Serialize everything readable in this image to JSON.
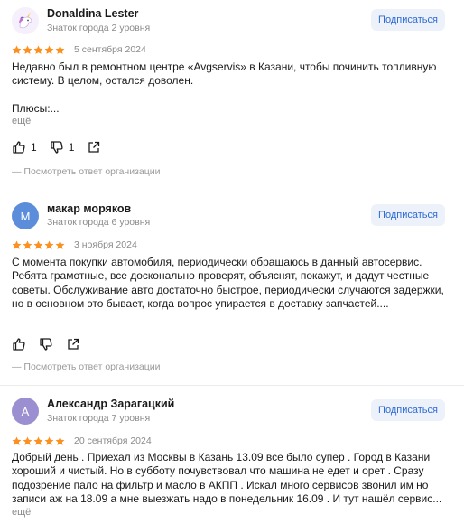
{
  "colors": {
    "star": "#fc8f1e",
    "accent": "#2e6bd6",
    "subscribe_bg": "#edf2fa",
    "muted": "#8a8a8a"
  },
  "reviews": [
    {
      "author": "Donaldina Lester",
      "level": "Знаток города 2 уровня",
      "subscribe_label": "Подписаться",
      "rating": 5,
      "date": "5 сентября 2024",
      "text": "Недавно был в ремонтном центре «Avgservis» в Казани, чтобы починить топливную систему. В целом, остался доволен.\n\nПлюсы:...",
      "more_label": "ещё",
      "likes": "1",
      "dislikes": "1",
      "org_answer_label": "— Посмотреть ответ организации",
      "avatar_icon": "unicorn-avatar-icon"
    },
    {
      "author": "макар моряков",
      "level": "Знаток города 6 уровня",
      "subscribe_label": "Подписаться",
      "rating": 5,
      "date": "3 ноября 2024",
      "text": "С момента покупки автомобиля, периодически обращаюсь в данный автосервис. Ребята грамотные, все досконально проверят, объяснят, покажут, и дадут честные советы. Обслуживание авто достаточно быстрое, периодически случаются задержки, но в основном это бывает, когда вопрос упирается в доставку запчастей....",
      "avatar_letter": "М",
      "avatar_color": "#5b8ddb",
      "org_answer_label": "— Посмотреть ответ организации"
    },
    {
      "author": "Александр Зарагацкий",
      "level": "Знаток города 7 уровня",
      "subscribe_label": "Подписаться",
      "rating": 5,
      "date": "20 сентября 2024",
      "text": "Добрый день . Приехал из Москвы в Казань 13.09 все было супер . Город в Казани хороший и чистый. Но в субботу почувствовал что машина не едет и орет . Сразу подозрение пало на фильтр и масло в АКПП . Искал много сервисов звонил им но записи аж на 18.09 а мне выезжать надо в понедельник 16.09 . И тут нашёл сервис...",
      "more_label": "ещё",
      "avatar_letter": "А",
      "avatar_color": "#9b8ed1"
    }
  ]
}
